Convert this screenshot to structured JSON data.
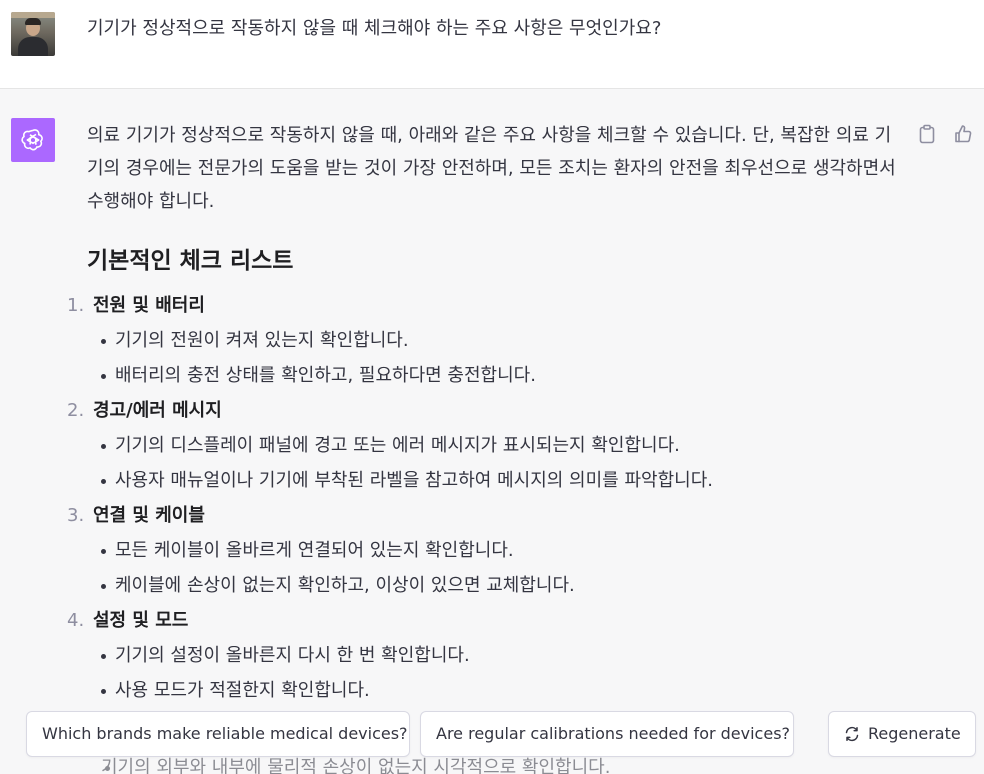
{
  "user": {
    "avatar": "user-photo",
    "message": "기기가 정상적으로 작동하지 않을 때 체크해야 하는 주요 사항은 무엇인가요?"
  },
  "assistant": {
    "avatar": "openai-logo-icon",
    "avatar_color": "#ab68ff",
    "intro": "의료 기기가 정상적으로 작동하지 않을 때, 아래와 같은 주요 사항을 체크할 수 있습니다. 단, 복잡한 의료 기기의 경우에는 전문가의 도움을 받는 것이 가장 안전하며, 모든 조치는 환자의 안전을 최우선으로 생각하면서 수행해야 합니다.",
    "heading": "기본적인 체크 리스트",
    "items": [
      {
        "num": "1.",
        "title": "전원 및 배터리",
        "bullets": [
          "기기의 전원이 켜져 있는지 확인합니다.",
          "배터리의 충전 상태를 확인하고, 필요하다면 충전합니다."
        ]
      },
      {
        "num": "2.",
        "title": "경고/에러 메시지",
        "bullets": [
          "기기의 디스플레이 패널에 경고 또는 에러 메시지가 표시되는지 확인합니다.",
          "사용자 매뉴얼이나 기기에 부착된 라벨을 참고하여 메시지의 의미를 파악합니다."
        ]
      },
      {
        "num": "3.",
        "title": "연결 및 케이블",
        "bullets": [
          "모든 케이블이 올바르게 연결되어 있는지 확인합니다.",
          "케이블에 손상이 없는지 확인하고, 이상이 있으면 교체합니다."
        ]
      },
      {
        "num": "4.",
        "title": "설정 및 모드",
        "bullets": [
          "기기의 설정이 올바른지 다시 한 번 확인합니다.",
          "사용 모드가 적절한지 확인합니다."
        ]
      }
    ],
    "cutoff_line": "기기의 외부와 내부에 물리적 손상이 없는지 시각적으로 확인합니다."
  },
  "actions": {
    "copy_icon": "clipboard-icon",
    "like_icon": "thumbs-up-icon"
  },
  "suggestions": [
    "Which brands make reliable medical devices?",
    "Are regular calibrations needed for devices?"
  ],
  "regenerate": {
    "label": "Regenerate",
    "icon": "refresh-icon"
  }
}
